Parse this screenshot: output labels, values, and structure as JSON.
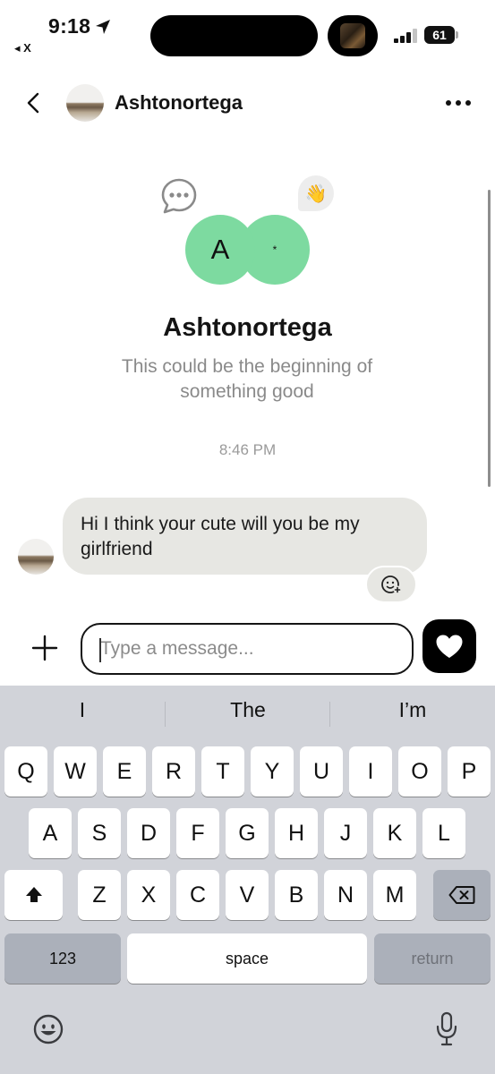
{
  "status_bar": {
    "time": "9:18",
    "back_app": "◂ X",
    "battery": "61"
  },
  "header": {
    "name": "Ashtonortega"
  },
  "match": {
    "initial_a": "A",
    "initial_b": "*",
    "name": "Ashtonortega",
    "subtitle": "This could be the beginning of something good"
  },
  "conversation": {
    "timestamp": "8:46 PM",
    "messages": [
      {
        "text": "Hi I think your cute will you be my girlfriend"
      }
    ]
  },
  "composer": {
    "placeholder": "Type a message..."
  },
  "keyboard": {
    "suggestions": [
      "I",
      "The",
      "I’m"
    ],
    "row1": [
      "Q",
      "W",
      "E",
      "R",
      "T",
      "Y",
      "U",
      "I",
      "O",
      "P"
    ],
    "row2": [
      "A",
      "S",
      "D",
      "F",
      "G",
      "H",
      "J",
      "K",
      "L"
    ],
    "row3": [
      "Z",
      "X",
      "C",
      "V",
      "B",
      "N",
      "M"
    ],
    "numbers_label": "123",
    "space_label": "space",
    "return_label": "return"
  },
  "colors": {
    "match_green": "#7ddaa0",
    "bubble_gray": "#e7e7e3",
    "keyboard_bg": "#d1d3d9"
  }
}
